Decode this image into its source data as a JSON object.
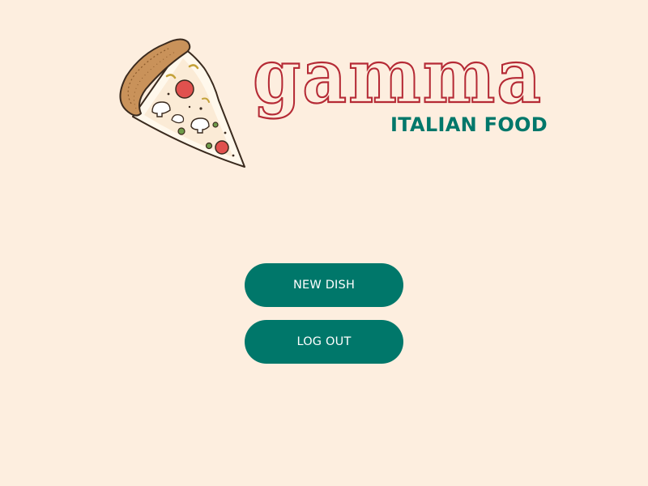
{
  "brand": {
    "name": "gamma",
    "tagline": "ITALIAN FOOD",
    "logo_icon": "pizza-slice-icon",
    "name_color": "#B52A35",
    "tagline_color": "#00776A"
  },
  "actions": {
    "new_dish_label": "NEW DISH",
    "logout_label": "LOG OUT",
    "button_color": "#00776A"
  },
  "colors": {
    "background": "#FDEEDF"
  }
}
